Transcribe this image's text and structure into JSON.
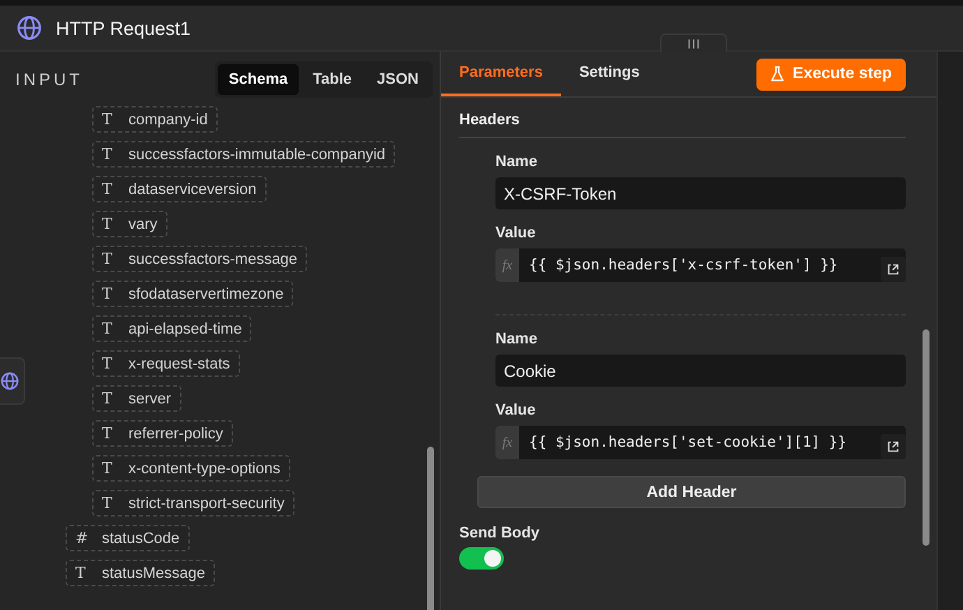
{
  "window": {
    "title": "HTTP Request1"
  },
  "input_panel": {
    "label": "INPUT",
    "view_tabs": [
      {
        "label": "Schema",
        "selected": true
      },
      {
        "label": "Table",
        "selected": false
      },
      {
        "label": "JSON",
        "selected": false
      }
    ],
    "fields": [
      {
        "children": [
          {
            "glyph": "T",
            "name": "company-id"
          },
          {
            "glyph": "T",
            "name": "successfactors-immutable-companyid"
          },
          {
            "glyph": "T",
            "name": "dataserviceversion"
          },
          {
            "glyph": "T",
            "name": "vary"
          },
          {
            "glyph": "T",
            "name": "successfactors-message"
          },
          {
            "glyph": "T",
            "name": "sfodataservertimezone"
          },
          {
            "glyph": "T",
            "name": "api-elapsed-time"
          },
          {
            "glyph": "T",
            "name": "x-request-stats"
          },
          {
            "glyph": "T",
            "name": "server"
          },
          {
            "glyph": "T",
            "name": "referrer-policy"
          },
          {
            "glyph": "T",
            "name": "x-content-type-options"
          },
          {
            "glyph": "T",
            "name": "strict-transport-security"
          }
        ]
      },
      {
        "glyph": "#",
        "name": "statusCode"
      },
      {
        "glyph": "T",
        "name": "statusMessage"
      }
    ]
  },
  "parameters_panel": {
    "tabs": [
      {
        "label": "Parameters",
        "selected": true
      },
      {
        "label": "Settings",
        "selected": false
      }
    ],
    "execute_button": "Execute step",
    "section_title": "Headers",
    "headers": [
      {
        "name_label": "Name",
        "name": "X-CSRF-Token",
        "value_label": "Value",
        "fx": "fx",
        "value": "{{ $json.headers['x-csrf-token'] }}"
      },
      {
        "name_label": "Name",
        "name": "Cookie",
        "value_label": "Value",
        "fx": "fx",
        "value": "{{ $json.headers['set-cookie'][1] }}"
      }
    ],
    "add_button": "Add Header",
    "send_body": {
      "label": "Send Body",
      "on": true
    }
  }
}
